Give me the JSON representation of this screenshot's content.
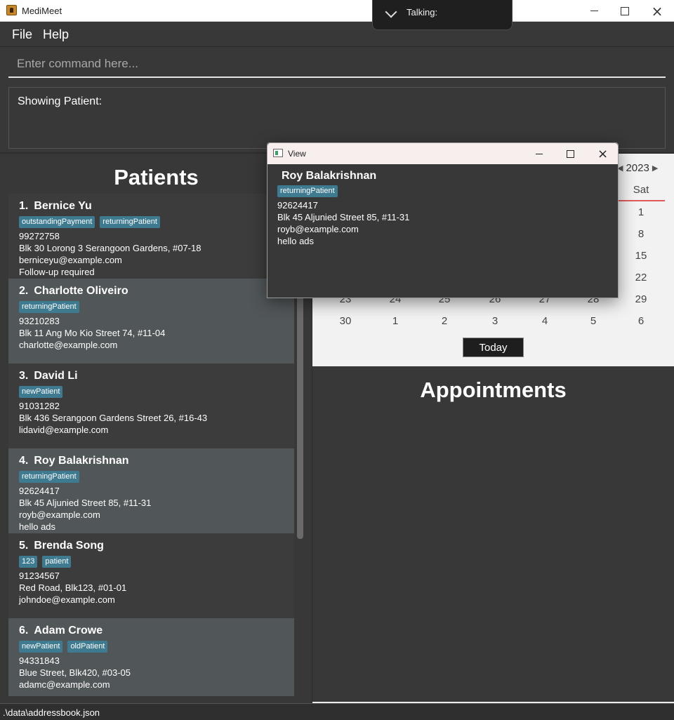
{
  "window": {
    "title": "MediMeet"
  },
  "talking": {
    "label": "Talking:"
  },
  "menu": {
    "file": "File",
    "help": "Help"
  },
  "command": {
    "placeholder": "Enter command here..."
  },
  "result": {
    "text": "Showing Patient:"
  },
  "patients": {
    "title": "Patients",
    "items": [
      {
        "index": "1.",
        "name": "Bernice Yu",
        "tags": [
          "outstandingPayment",
          "returningPatient"
        ],
        "lines": [
          "99272758",
          "Blk 30 Lorong 3 Serangoon Gardens, #07-18",
          "berniceyu@example.com",
          "Follow-up required"
        ]
      },
      {
        "index": "2.",
        "name": "Charlotte Oliveiro",
        "tags": [
          "returningPatient"
        ],
        "lines": [
          "93210283",
          "Blk 11 Ang Mo Kio Street 74, #11-04",
          "charlotte@example.com"
        ]
      },
      {
        "index": "3.",
        "name": "David Li",
        "tags": [
          "newPatient"
        ],
        "lines": [
          "91031282",
          "Blk 436 Serangoon Gardens Street 26, #16-43",
          "lidavid@example.com"
        ]
      },
      {
        "index": "4.",
        "name": "Roy Balakrishnan",
        "tags": [
          "returningPatient"
        ],
        "lines": [
          "92624417",
          "Blk 45 Aljunied Street 85, #11-31",
          "royb@example.com",
          "hello ads"
        ]
      },
      {
        "index": "5.",
        "name": "Brenda Song",
        "tags": [
          "123",
          "patient"
        ],
        "lines": [
          "91234567",
          "Red Road, Blk123, #01-01",
          "johndoe@example.com"
        ]
      },
      {
        "index": "6.",
        "name": "Adam Crowe",
        "tags": [
          "newPatient",
          "oldPatient"
        ],
        "lines": [
          "94331843",
          "Blue Street, Blk420, #03-05",
          "adamc@example.com"
        ]
      }
    ]
  },
  "calendar": {
    "year": "2023",
    "saturday_header": "Sat",
    "rows": [
      [
        "",
        "",
        "",
        "",
        "",
        "",
        "1"
      ],
      [
        "",
        "",
        "",
        "",
        "",
        "",
        "8"
      ],
      [
        "",
        "",
        "",
        "",
        "",
        "",
        "15"
      ],
      [
        "",
        "",
        "",
        "",
        "",
        "",
        "22"
      ],
      [
        "23",
        "24",
        "25",
        "26",
        "27",
        "28",
        "29"
      ],
      [
        "30",
        "1",
        "2",
        "3",
        "4",
        "5",
        "6"
      ]
    ],
    "today_label": "Today"
  },
  "appointments": {
    "title": "Appointments"
  },
  "status": {
    "path": ".\\data\\addressbook.json"
  },
  "view": {
    "title": "View",
    "name": "Roy Balakrishnan",
    "tags": [
      "returningPatient"
    ],
    "lines": [
      "92624417",
      "Blk 45 Aljunied Street 85, #11-31",
      "royb@example.com",
      "hello ads"
    ]
  }
}
